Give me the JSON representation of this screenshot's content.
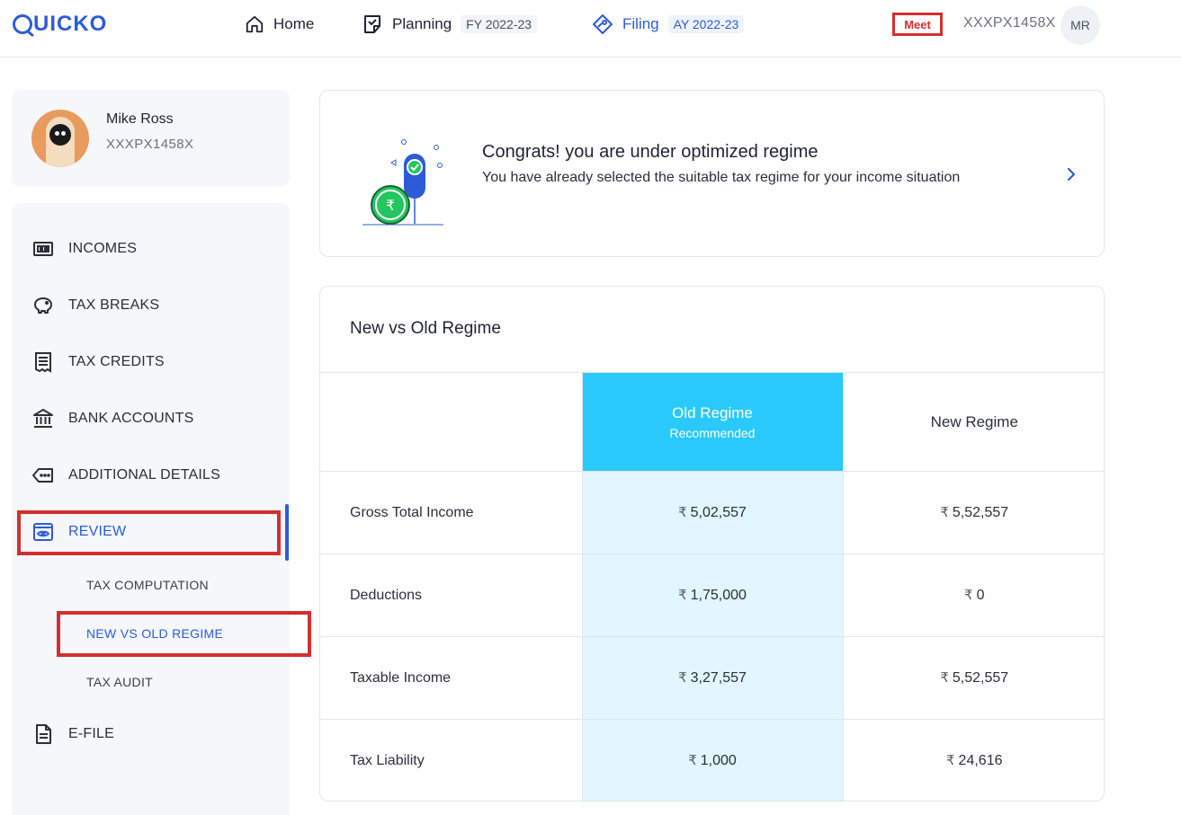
{
  "header": {
    "logo_text": "UICKO",
    "nav": [
      {
        "label": "Home",
        "icon": "home-icon"
      },
      {
        "label": "Planning",
        "badge": "FY 2022-23",
        "icon": "planning-icon"
      },
      {
        "label": "Filing",
        "badge": "AY 2022-23",
        "icon": "filing-icon"
      }
    ],
    "meet_label": "Meet",
    "pan": "XXXPX1458X",
    "avatar_initials": "MR"
  },
  "profile": {
    "name": "Mike Ross",
    "pan": "XXXPX1458X"
  },
  "sidebar": {
    "items": [
      {
        "label": "INCOMES",
        "icon": "incomes-icon"
      },
      {
        "label": "TAX BREAKS",
        "icon": "piggy-bank-icon"
      },
      {
        "label": "TAX CREDITS",
        "icon": "receipt-icon"
      },
      {
        "label": "BANK ACCOUNTS",
        "icon": "bank-icon"
      },
      {
        "label": "ADDITIONAL DETAILS",
        "icon": "tag-icon"
      },
      {
        "label": "REVIEW",
        "icon": "review-eye-icon",
        "active": true
      },
      {
        "label": "E-FILE",
        "icon": "document-icon"
      }
    ],
    "review_sub": [
      {
        "label": "TAX COMPUTATION"
      },
      {
        "label": "NEW VS OLD REGIME",
        "active": true
      },
      {
        "label": "TAX AUDIT"
      }
    ]
  },
  "congrats": {
    "title": "Congrats! you are under optimized regime",
    "text": "You have already selected the suitable tax regime for your income situation"
  },
  "regime": {
    "title": "New vs Old Regime",
    "old_label": "Old Regime",
    "old_sub": "Recommended",
    "new_label": "New Regime",
    "currency": "₹",
    "rows": [
      {
        "label": "Gross Total Income",
        "old": "5,02,557",
        "new": "5,52,557"
      },
      {
        "label": "Deductions",
        "old": "1,75,000",
        "new": "0"
      },
      {
        "label": "Taxable Income",
        "old": "3,27,557",
        "new": "5,52,557"
      },
      {
        "label": "Tax Liability",
        "old": "1,000",
        "new": "24,616"
      }
    ]
  },
  "colors": {
    "brand": "#2d5bd8",
    "recommended": "#2ac9fb",
    "highlight": "#d32f2f"
  }
}
